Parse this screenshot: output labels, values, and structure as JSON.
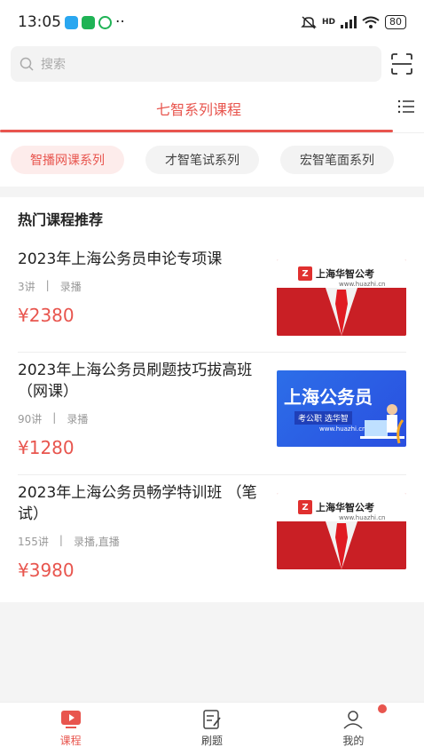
{
  "status": {
    "time": "13:05",
    "battery": "80",
    "network": "HD"
  },
  "search": {
    "placeholder": "搜索"
  },
  "tab": {
    "title": "七智系列课程"
  },
  "chips": [
    "智播网课系列",
    "才智笔试系列",
    "宏智笔面系列"
  ],
  "section": {
    "title": "热门课程推荐"
  },
  "courses": [
    {
      "title": "2023年上海公务员申论专项课",
      "lessons": "3讲",
      "type": "录播",
      "price": "¥2380",
      "banner": "red"
    },
    {
      "title": "2023年上海公务员刷题技巧拔高班（网课）",
      "lessons": "90讲",
      "type": "录播",
      "price": "¥1280",
      "banner": "blue"
    },
    {
      "title": "2023年上海公务员畅学特训班 （笔试）",
      "lessons": "155讲",
      "type": "录播,直播",
      "price": "¥3980",
      "banner": "red"
    }
  ],
  "banners": {
    "red_brand": "上海华智公考",
    "red_url": "www.huazhi.cn",
    "blue_title": "上海公务员",
    "blue_sub": "考公职 选华智",
    "blue_url": "www.huazhi.cn"
  },
  "bottom_nav": {
    "items": [
      {
        "label": "课程"
      },
      {
        "label": "刷题"
      },
      {
        "label": "我的"
      }
    ]
  },
  "colors": {
    "accent": "#e8554e"
  }
}
